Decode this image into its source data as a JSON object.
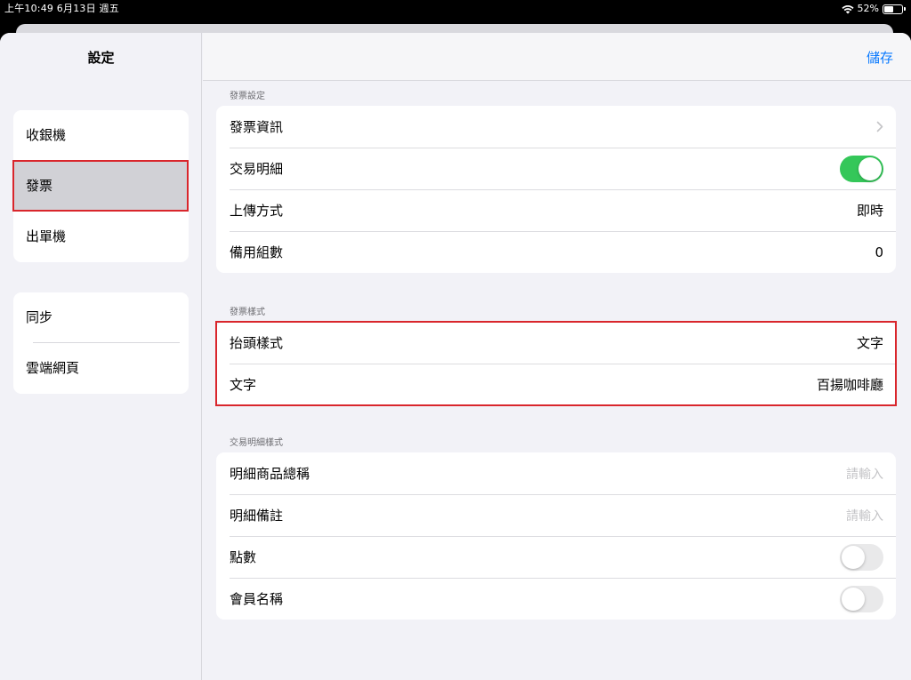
{
  "status_bar": {
    "time_date": "上午10:49  6月13日 週五",
    "battery_text": "52%",
    "battery_level": 0.52,
    "wifi_icon": "wifi-icon",
    "battery_icon": "battery-icon"
  },
  "sidebar": {
    "title": "設定",
    "groups": [
      {
        "items": [
          {
            "label": "收銀機"
          },
          {
            "label": "發票",
            "selected": true
          },
          {
            "label": "出單機"
          }
        ]
      },
      {
        "items": [
          {
            "label": "同步"
          },
          {
            "label": "雲端網頁"
          }
        ]
      }
    ]
  },
  "navbar": {
    "save_label": "儲存"
  },
  "sections": [
    {
      "header": "發票設定",
      "rows": [
        {
          "label": "發票資訊",
          "accessory": "chevron"
        },
        {
          "label": "交易明細",
          "accessory": "toggle",
          "on": true
        },
        {
          "label": "上傳方式",
          "value": "即時"
        },
        {
          "label": "備用組數",
          "value": "0"
        }
      ]
    },
    {
      "header": "發票樣式",
      "rows": [
        {
          "label": "抬頭樣式",
          "value": "文字"
        },
        {
          "label": "文字",
          "value": "百揚咖啡廳"
        }
      ]
    },
    {
      "header": "交易明細樣式",
      "rows": [
        {
          "label": "明細商品總稱",
          "placeholder": "請輸入"
        },
        {
          "label": "明細備註",
          "placeholder": "請輸入"
        },
        {
          "label": "點數",
          "accessory": "toggle",
          "on": false
        },
        {
          "label": "會員名稱",
          "accessory": "toggle",
          "on": false
        }
      ]
    }
  ],
  "colors": {
    "accent": "#0a7aff",
    "toggle_on": "#34c759",
    "highlight_box": "#d9262c",
    "selected_row": "#d1d1d6",
    "background": "#f2f2f7"
  }
}
